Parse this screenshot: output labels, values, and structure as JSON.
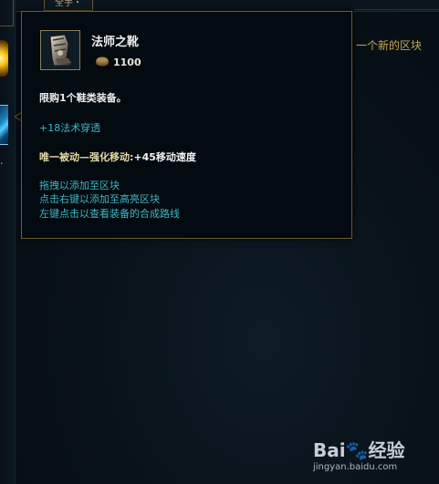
{
  "top_tab": {
    "label": "全手・"
  },
  "right_panel": {
    "text": "一个新的区块"
  },
  "left_strip": {
    "dot": "."
  },
  "tooltip": {
    "item_name": "法师之靴",
    "price": "1100",
    "limit_text": "限购1个鞋类装备。",
    "stat_text": "+18法术穿透",
    "passive_label": "唯一被动—强化移动:",
    "passive_value": "+45移动速度",
    "help_lines": [
      "拖拽以添加至区块",
      "点击右键以添加至高亮区块",
      "左键点击以查看装备的合成路线"
    ]
  },
  "watermark": {
    "logo": "Bai🐾经验",
    "url": "jingyan.baidu.com"
  },
  "colors": {
    "tooltip_border": "#6b5b2e",
    "stat_text": "#3fb8c6",
    "passive_label": "#e8d9a6",
    "accent_gold": "#c9a64a"
  },
  "icons": {
    "item": "sorcerers-shoes-icon",
    "gold": "gold-coins-icon"
  }
}
